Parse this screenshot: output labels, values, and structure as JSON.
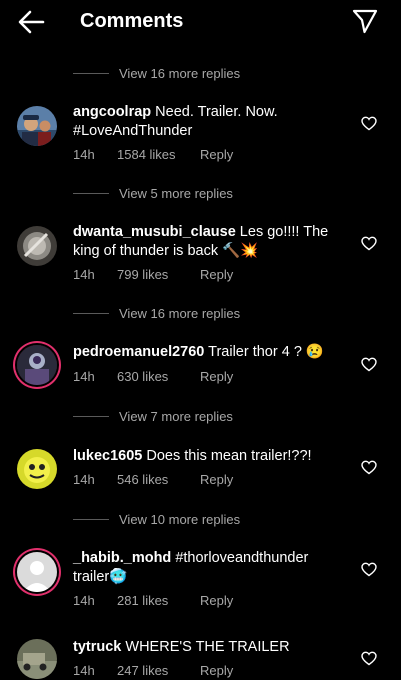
{
  "header": {
    "title": "Comments"
  },
  "comments": [
    {
      "view_replies": "View 16 more replies",
      "username": "angcoolrap",
      "text": " Need. Trailer. Now. #LoveAndThunder",
      "time": "14h",
      "likes": "1584 likes",
      "reply": "Reply"
    },
    {
      "view_replies": "View 5 more replies",
      "username": "dwanta_musubi_clause",
      "text": " Les go!!!! The king of thunder is back 🔨💥",
      "time": "14h",
      "likes": "799 likes",
      "reply": "Reply"
    },
    {
      "view_replies": "View 16 more replies",
      "username": "pedroemanuel2760",
      "text": " Trailer thor 4 ? 😢",
      "time": "14h",
      "likes": "630 likes",
      "reply": "Reply"
    },
    {
      "view_replies": "View 7 more replies",
      "username": "lukec1605",
      "text": " Does this mean trailer!??!",
      "time": "14h",
      "likes": "546 likes",
      "reply": "Reply"
    },
    {
      "view_replies": "View 10 more replies",
      "username": "_habib._mohd",
      "text": " #thorloveandthunder trailer🥶",
      "time": "14h",
      "likes": "281 likes",
      "reply": "Reply"
    },
    {
      "username": "tytruck",
      "text": " WHERE'S THE TRAILER",
      "time": "14h",
      "likes": "247 likes",
      "reply": "Reply"
    }
  ]
}
